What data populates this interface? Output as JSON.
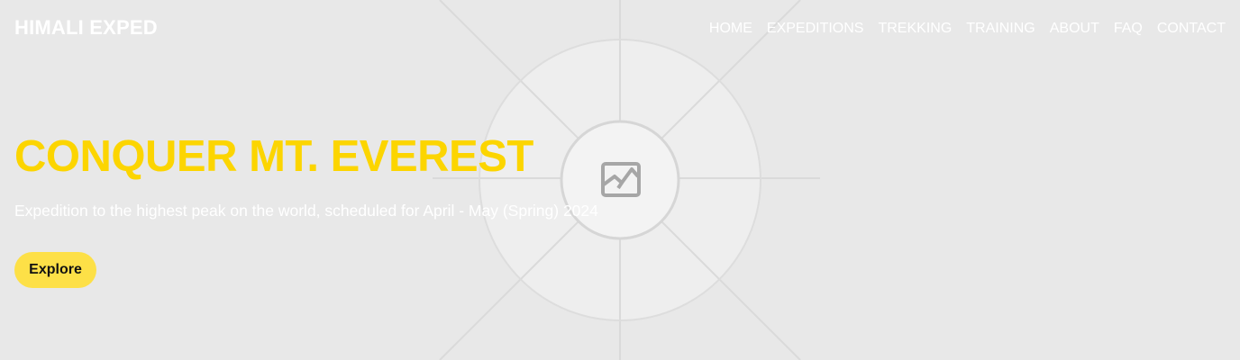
{
  "brand": "HIMALI EXPED",
  "nav": [
    {
      "label": "HOME"
    },
    {
      "label": "EXPEDITIONS"
    },
    {
      "label": "TREKKING"
    },
    {
      "label": "TRAINING"
    },
    {
      "label": "ABOUT"
    },
    {
      "label": "FAQ"
    },
    {
      "label": "CONTACT"
    }
  ],
  "hero": {
    "title": "CONQUER MT. EVEREST",
    "subtitle": "Expedition to the highest peak on the world, scheduled for April - May (Spring) 2024",
    "button": "Explore",
    "background_icon": "image-placeholder-icon"
  },
  "colors": {
    "accent": "#fcd500",
    "button": "#fde047",
    "background": "#e8e8e8"
  }
}
